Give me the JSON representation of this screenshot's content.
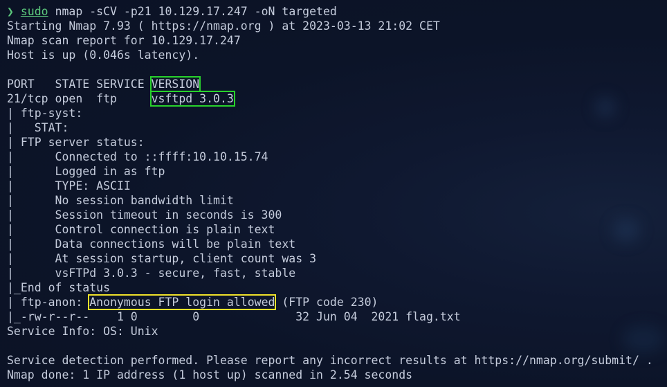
{
  "colors": {
    "background": "#0c1428",
    "text": "#c5ccdc",
    "prompt": "#5cc87c",
    "highlight_version": "#28d22c",
    "highlight_anon": "#f0e12a"
  },
  "terminal": {
    "prompt_symbol": "❯",
    "command_name": "sudo",
    "command_args": "nmap -sCV -p21 10.129.17.247 -oN targeted",
    "lines": [
      "Starting Nmap 7.93 ( https://nmap.org ) at 2023-03-13 21:02 CET",
      "Nmap scan report for 10.129.17.247",
      "Host is up (0.046s latency).",
      ""
    ],
    "header_prefix": "PORT   STATE SERVICE ",
    "header_version": "VERSION",
    "port_prefix": "21/tcp open  ftp     ",
    "port_version": "vsftpd 3.0.3",
    "details": [
      "| ftp-syst:",
      "|   STAT:",
      "| FTP server status:",
      "|      Connected to ::ffff:10.10.15.74",
      "|      Logged in as ftp",
      "|      TYPE: ASCII",
      "|      No session bandwidth limit",
      "|      Session timeout in seconds is 300",
      "|      Control connection is plain text",
      "|      Data connections will be plain text",
      "|      At session startup, client count was 3",
      "|      vsFTPd 3.0.3 - secure, fast, stable",
      "|_End of status"
    ],
    "anon_prefix": "| ftp-anon: ",
    "anon_highlight": "Anonymous FTP login allowed",
    "anon_suffix": " (FTP code 230)",
    "tail": [
      "|_-rw-r--r--    1 0        0              32 Jun 04  2021 flag.txt",
      "Service Info: OS: Unix",
      "",
      "Service detection performed. Please report any incorrect results at https://nmap.org/submit/ .",
      "Nmap done: 1 IP address (1 host up) scanned in 2.54 seconds"
    ]
  }
}
